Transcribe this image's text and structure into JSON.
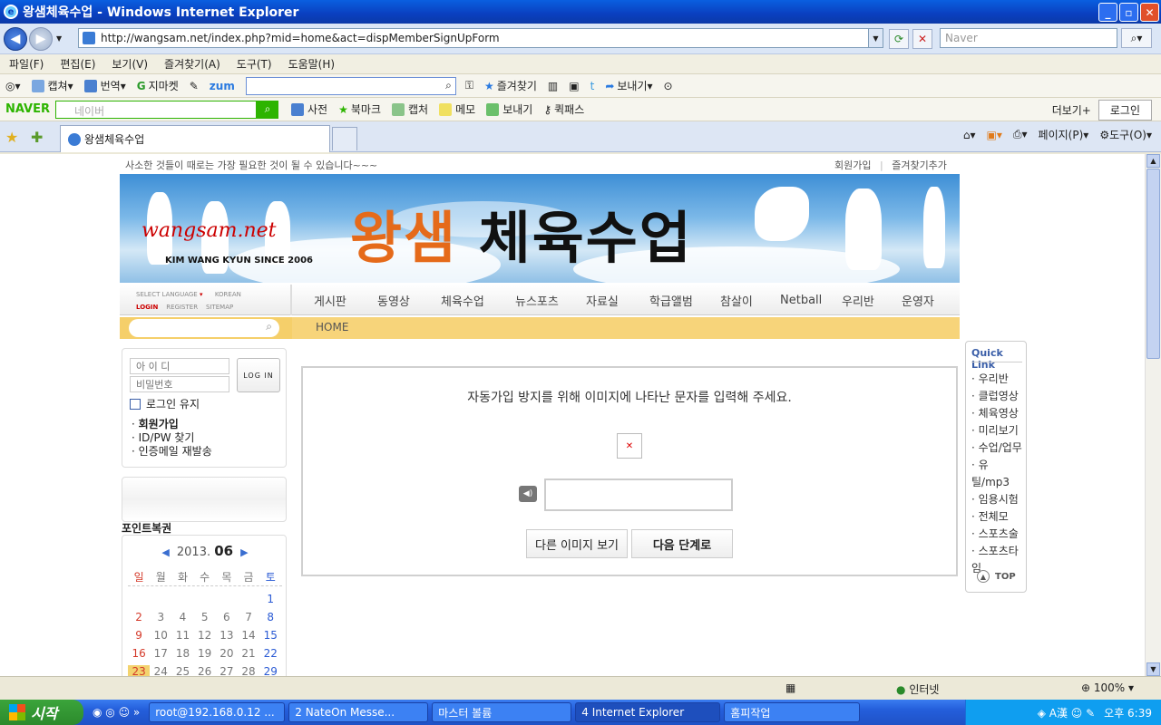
{
  "window": {
    "title": "왕샘체육수업 - Windows Internet Explorer"
  },
  "address": {
    "url": "http://wangsam.net/index.php?mid=home&act=dispMemberSignUpForm",
    "search_placeholder": "Naver"
  },
  "menubar": [
    "파일(F)",
    "편집(E)",
    "보기(V)",
    "즐겨찾기(A)",
    "도구(T)",
    "도움말(H)"
  ],
  "toolbar1": {
    "capture": "캡쳐",
    "translate": "번역",
    "gmarket": "지마켓",
    "zum": "zum",
    "favorites": "즐겨찾기",
    "send": "보내기"
  },
  "toolbar2": {
    "brand": "NAVER",
    "search_placeholder": "네이버",
    "dictionary": "사전",
    "bookmark": "북마크",
    "capture": "캡처",
    "memo": "메모",
    "send": "보내기",
    "quickpass": "퀵패스",
    "more": "더보기+",
    "login": "로그인"
  },
  "tab": {
    "title": "왕샘체육수업"
  },
  "tabtools": {
    "page": "페이지(P)",
    "tools": "도구(O)"
  },
  "page": {
    "slogan": "사소한 것들이 때로는 가장 필요한 것이 될 수 있습니다~~~",
    "toplinks": [
      "회원가입",
      "즐겨찾기추가"
    ],
    "banner": {
      "title_a": "왕샘",
      "title_b": "체육수업",
      "logo": "wangsam.net",
      "since": "KIM WANG KYUN SINCE 2006"
    },
    "lang": {
      "select": "SELECT LANGUAGE",
      "korean": "KOREAN",
      "login": "LOGIN",
      "register": "REGISTER",
      "sitemap": "SITEMAP"
    },
    "nav": [
      "게시판",
      "동영상",
      "체육수업",
      "뉴스포츠",
      "자료실",
      "학급앨범",
      "참살이",
      "Netball",
      "우리반",
      "운영자"
    ],
    "breadcrumb": "HOME",
    "login": {
      "id_placeholder": "아 이 디",
      "pw_placeholder": "비밀번호",
      "button": "LOG IN",
      "keep": "로그인 유지",
      "join": "회원가입",
      "find": "ID/PW 찾기",
      "resend": "인증메일 재발송"
    },
    "point_title": "포인트복권",
    "calendar": {
      "year": "2013.",
      "month": "06",
      "weekdays": [
        "일",
        "월",
        "화",
        "수",
        "목",
        "금",
        "토"
      ],
      "weeks": [
        [
          "",
          "",
          "",
          "",
          "",
          "",
          "1"
        ],
        [
          "2",
          "3",
          "4",
          "5",
          "6",
          "7",
          "8"
        ],
        [
          "9",
          "10",
          "11",
          "12",
          "13",
          "14",
          "15"
        ],
        [
          "16",
          "17",
          "18",
          "19",
          "20",
          "21",
          "22"
        ],
        [
          "23",
          "24",
          "25",
          "26",
          "27",
          "28",
          "29"
        ]
      ],
      "today": "23"
    },
    "captcha": {
      "message": "자동가입 방지를 위해 이미지에 나타난 문자를 입력해 주세요.",
      "other_image": "다른 이미지 보기",
      "next": "다음 단계로"
    },
    "quick": {
      "title": "Quick Link",
      "items": [
        "우리반",
        "클럽영상",
        "체육영상",
        "미리보기",
        "수업/업무",
        "유틸/mp3",
        "임용시험",
        "전체모",
        "스포츠술",
        "스포츠타임"
      ],
      "top": "TOP"
    }
  },
  "statusbar": {
    "zone": "인터넷",
    "zoom": "100%"
  },
  "taskbar": {
    "start": "시작",
    "tasks": [
      "root@192.168.0.12 ...",
      "2 NateOn Messe...",
      "마스터 볼륨",
      "4 Internet Explorer",
      "홈피작업"
    ],
    "time": "오후 6:39"
  }
}
